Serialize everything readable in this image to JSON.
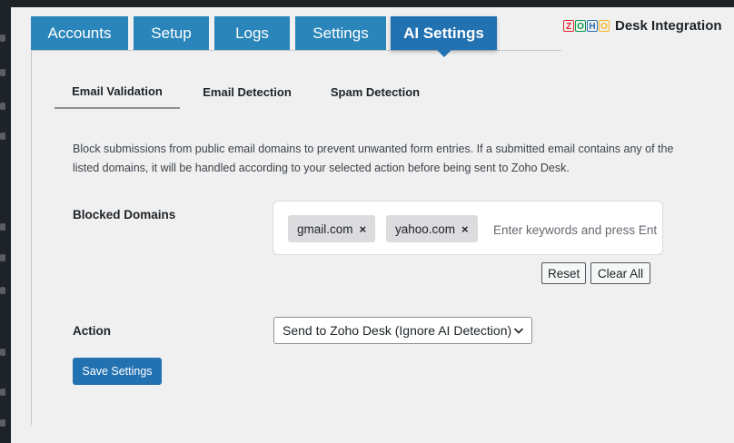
{
  "main_tabs": [
    {
      "label": "Accounts"
    },
    {
      "label": "Setup"
    },
    {
      "label": "Logs"
    },
    {
      "label": "Settings"
    },
    {
      "label": "AI Settings",
      "active": true
    }
  ],
  "brand": {
    "logo_letters": [
      "Z",
      "O",
      "H",
      "O"
    ],
    "logo_colors": [
      "#e42527",
      "#089949",
      "#226db4",
      "#f9b21d"
    ],
    "title": "Desk Integration"
  },
  "sub_tabs": [
    {
      "label": "Email Validation",
      "active": true
    },
    {
      "label": "Email Detection"
    },
    {
      "label": "Spam Detection"
    }
  ],
  "description": "Block submissions from public email domains to prevent unwanted form entries. If a submitted email contains any of the listed domains, it will be handled according to your selected action before being sent to Zoho Desk.",
  "blocked_domains": {
    "label": "Blocked Domains",
    "tags": [
      "gmail.com",
      "yahoo.com"
    ],
    "remove_symbol": "×",
    "placeholder": "Enter keywords and press Enter",
    "reset_label": "Reset",
    "clear_all_label": "Clear All"
  },
  "action": {
    "label": "Action",
    "selected": "Send to Zoho Desk (Ignore AI Detection)"
  },
  "save_label": "Save Settings",
  "colors": {
    "accent": "#2271b1",
    "tab": "#2a86ba",
    "background": "#f0f0f1"
  }
}
